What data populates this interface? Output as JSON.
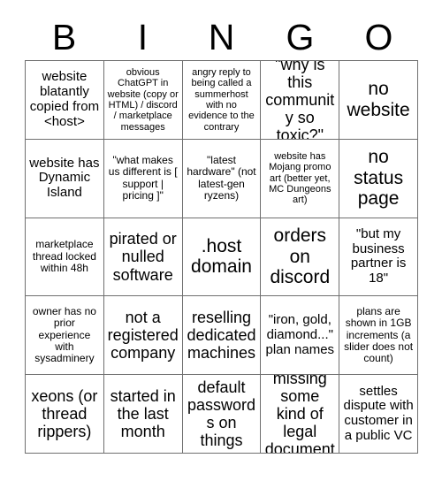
{
  "header": {
    "letters": [
      "B",
      "I",
      "N",
      "G",
      "O"
    ]
  },
  "grid": {
    "columns": 5,
    "rows": 5,
    "border_color": "#6f6f6f",
    "background_color": "#ffffff",
    "text_color": "#000000",
    "cells": [
      {
        "text": "website blatantly copied from <host>",
        "size": "sz-md"
      },
      {
        "text": "obvious ChatGPT in website (copy or HTML) / discord / marketplace messages",
        "size": "sz-xs"
      },
      {
        "text": "angry reply to being called a summerhost with no evidence to the contrary",
        "size": "sz-xs"
      },
      {
        "text": "\"why is this community so toxic?\"",
        "size": "sz-lg"
      },
      {
        "text": "no website",
        "size": "sz-xl"
      },
      {
        "text": "website has Dynamic Island",
        "size": "sz-md"
      },
      {
        "text": "\"what makes us different is [ support | pricing ]\"",
        "size": "sz-sm"
      },
      {
        "text": "\"latest hardware\" (not latest-gen ryzens)",
        "size": "sz-sm"
      },
      {
        "text": "website has Mojang promo art (better yet, MC Dungeons art)",
        "size": "sz-xs"
      },
      {
        "text": "no status page",
        "size": "sz-xl"
      },
      {
        "text": "marketplace thread locked within 48h",
        "size": "sz-sm"
      },
      {
        "text": "pirated or nulled software",
        "size": "sz-lg"
      },
      {
        "text": ".host domain",
        "size": "sz-xl"
      },
      {
        "text": "orders on discord",
        "size": "sz-xl"
      },
      {
        "text": "\"but my business partner is 18\"",
        "size": "sz-md"
      },
      {
        "text": "owner has no prior experience with sysadminery",
        "size": "sz-sm"
      },
      {
        "text": "not a registered company",
        "size": "sz-lg"
      },
      {
        "text": "reselling dedicated machines",
        "size": "sz-lg"
      },
      {
        "text": "\"iron, gold, diamond...\" plan names",
        "size": "sz-md"
      },
      {
        "text": "plans are shown in 1GB increments (a slider does not count)",
        "size": "sz-sm"
      },
      {
        "text": "xeons (or thread rippers)",
        "size": "sz-lg"
      },
      {
        "text": "started in the last month",
        "size": "sz-lg"
      },
      {
        "text": "default passwords on things",
        "size": "sz-lg"
      },
      {
        "text": "missing some kind of legal document",
        "size": "sz-lg"
      },
      {
        "text": "settles dispute with customer in a public VC",
        "size": "sz-md"
      }
    ]
  }
}
